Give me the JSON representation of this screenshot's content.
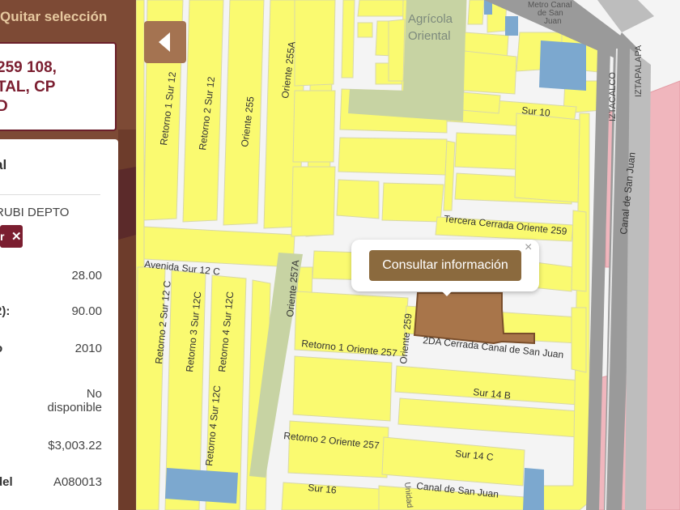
{
  "panel": {
    "clear_selection": "Quitar selección",
    "address": "259 108, TAL, CP D",
    "address_line1": "259 108,",
    "address_line2": "TAL, CP",
    "address_line3": "D",
    "card_heading": "al",
    "card_sub": "RUBI DEPTO",
    "chip_label": "r",
    "chip_close": "✕",
    "rows": [
      {
        "label": "",
        "value": "28.00"
      },
      {
        "label": "2):",
        "value": "90.00"
      },
      {
        "label": "o",
        "value": "2010"
      },
      {
        "label": "",
        "value": "No disponible",
        "value_line1": "No",
        "value_line2": "disponible"
      },
      {
        "label": "",
        "value": "$3,003.22"
      },
      {
        "label": "del",
        "value": "A080013"
      }
    ]
  },
  "popup": {
    "button_label": "Consultar información",
    "close": "×"
  },
  "map": {
    "areas": {
      "agricola_1": "Agrícola",
      "agricola_2": "Oriental",
      "metro_1": "Metro Canal",
      "metro_2": "de San",
      "metro_3": "Juan"
    },
    "streets": {
      "retorno1sur12": "Retorno 1 Sur 12",
      "retorno2sur12": "Retorno 2 Sur 12",
      "oriente255": "Oriente 255",
      "oriente255a": "Oriente 255A",
      "sur10": "Sur 10",
      "iztacalco": "IZTACALCO",
      "iztapalapa": "IZTAPALAPA",
      "canaldesanjuan_v": "Canal de San Juan",
      "tercera_cerrada": "Tercera Cerrada Oriente 259",
      "avenida_sur12c": "Avenida Sur 12 C",
      "oriente257a": "Oriente 257A",
      "retorno2sur12c": "Retorno 2 Sur 12 C",
      "retorno3sur12c": "Retorno 3 Sur 12C",
      "retorno4sur12c_a": "Retorno 4 Sur 12C",
      "retorno4sur12c_b": "Retorno 4 Sur 12C",
      "retorno1oriente257": "Retorno 1 Oriente 257",
      "oriente259": "Oriente 259",
      "cerrada_canal": "2DA Cerrada Canal de San Juan",
      "sur14b": "Sur 14 B",
      "retorno2oriente257": "Retorno 2 Oriente 257",
      "sur14c": "Sur 14 C",
      "sur16": "Sur 16",
      "unidad": "Unidad",
      "canaldesanjuan_b": "Canal de San Juan",
      "retorno1sur12c_side": "Retorno 1 Sur 12C"
    }
  },
  "colors": {
    "block": "#fafa70",
    "road": "#ffffff",
    "highway": "#9a9a9a",
    "park": "#c7d3a3",
    "water": "#7ca8cf",
    "pink": "#f0b6bd",
    "selected": "#a8754a",
    "panel": "#7d4a35",
    "accent": "#7b1e30"
  }
}
